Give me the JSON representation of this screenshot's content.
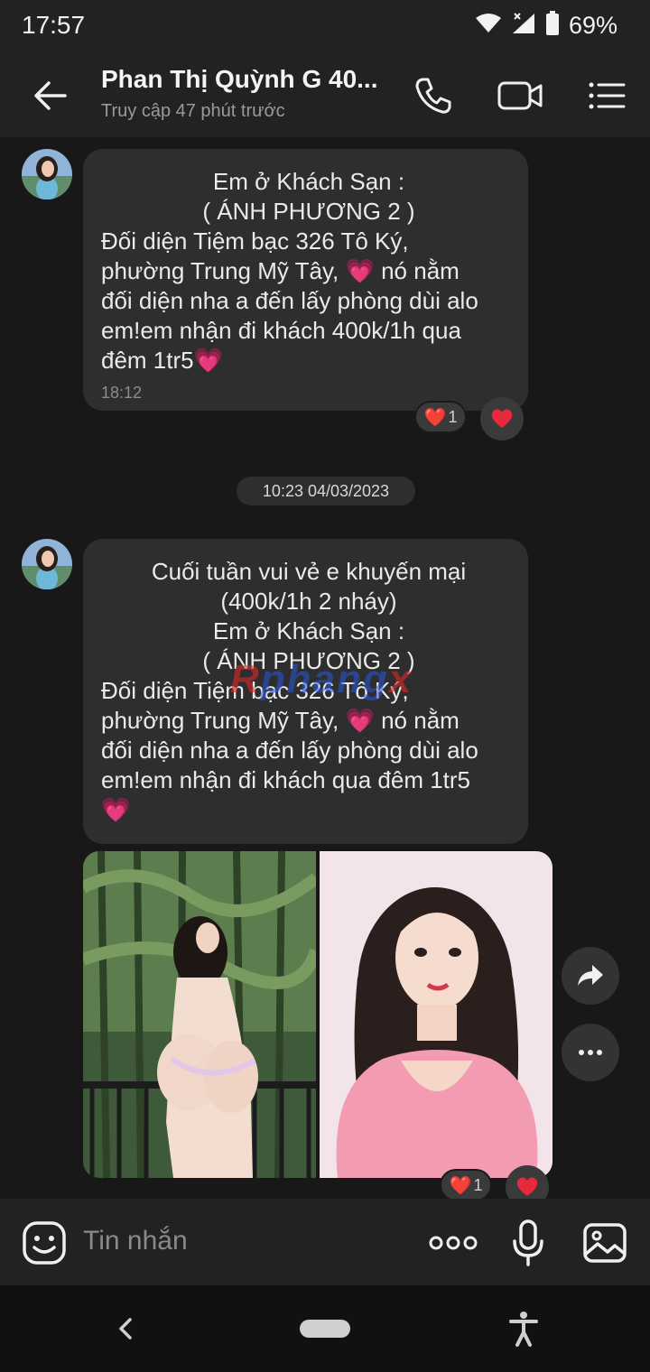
{
  "status_bar": {
    "time": "17:57",
    "battery": "69%",
    "icons": [
      "wifi-icon",
      "signal-icon",
      "battery-icon"
    ]
  },
  "header": {
    "contact_name": "Phan Thị Quỳnh G 40...",
    "last_seen": "Truy cập 47 phút trước",
    "icons": [
      "back-arrow-icon",
      "phone-icon",
      "video-call-icon",
      "menu-list-icon"
    ]
  },
  "messages": [
    {
      "lines": [
        "Em ở Khách Sạn :",
        "( ÁNH PHƯƠNG 2 )",
        "Đối diện  Tiệm bạc 326 Tô Ký,",
        "phường Trung Mỹ Tây, 💗 nó nằm",
        "đối diện nha a đến lấy phòng dùi alo",
        "em!em nhận đi khách 400k/1h qua",
        "đêm 1tr5💗"
      ],
      "time": "18:12",
      "reaction_emoji": "❤️",
      "reaction_count": "1"
    },
    {
      "lines": [
        "Cuối tuần vui vẻ e khuyến mại",
        "(400k/1h  2 nháy)",
        "Em ở Khách Sạn :",
        "( ÁNH PHƯƠNG 2 )",
        "Đối diện  Tiệm bạc 326 Tô Ký,",
        "phường Trung Mỹ Tây, 💗 nó nằm",
        "đối diện nha a đến lấy phòng dùi alo",
        "em!em nhận đi khách qua đêm 1tr5",
        "💗"
      ],
      "reaction_emoji": "❤️",
      "reaction_count": "1"
    }
  ],
  "date_separator": "10:23 04/03/2023",
  "watermark": {
    "prefix": "R",
    "rest": "phang",
    "suffix": "x"
  },
  "input": {
    "placeholder": "Tin nhắn",
    "icons": [
      "sticker-icon",
      "more-options-icon",
      "microphone-icon",
      "image-gallery-icon"
    ]
  },
  "nav": {
    "icons": [
      "nav-back-icon",
      "home-pill-icon",
      "accessibility-icon"
    ]
  },
  "colors": {
    "background": "#181818",
    "bar": "#222222",
    "bubble": "#2e2e2e",
    "heart": "#e8283c"
  }
}
